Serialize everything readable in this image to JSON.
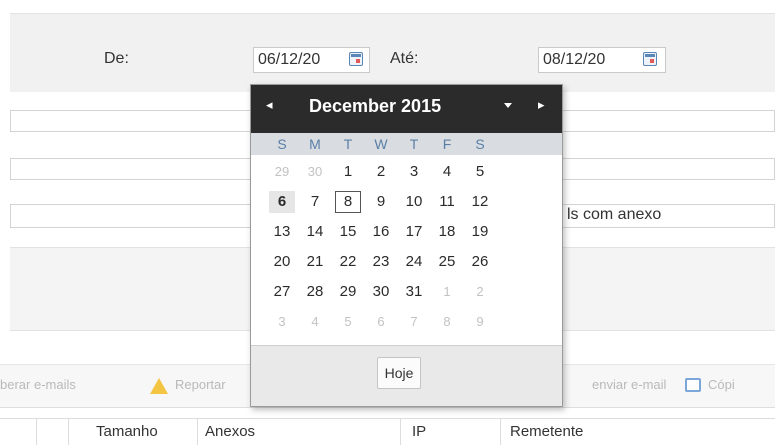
{
  "filter": {
    "from_label": "De:",
    "from_value": "06/12/20",
    "to_label": "Até:",
    "to_value": "08/12/20",
    "attachment_text": "ls com anexo"
  },
  "toolbar": {
    "recover": "berar e-mails",
    "report": "Reportar",
    "resend": "enviar e-mail",
    "copy": "Cópi"
  },
  "table": {
    "columns": [
      "Tamanho",
      "Anexos",
      "IP",
      "Remetente"
    ]
  },
  "datepicker": {
    "prev_icon": "◂",
    "next_icon": "▸",
    "month_label": "December 2015",
    "weekdays": [
      "S",
      "M",
      "T",
      "W",
      "T",
      "F",
      "S"
    ],
    "weeks": [
      [
        "29",
        "30",
        "1",
        "2",
        "3",
        "4",
        "5"
      ],
      [
        "6",
        "7",
        "8",
        "9",
        "10",
        "11",
        "12"
      ],
      [
        "13",
        "14",
        "15",
        "16",
        "17",
        "18",
        "19"
      ],
      [
        "20",
        "21",
        "22",
        "23",
        "24",
        "25",
        "26"
      ],
      [
        "27",
        "28",
        "29",
        "30",
        "31",
        "1",
        "2"
      ],
      [
        "3",
        "4",
        "5",
        "6",
        "7",
        "8",
        "9"
      ]
    ],
    "today_label": "Hoje"
  }
}
